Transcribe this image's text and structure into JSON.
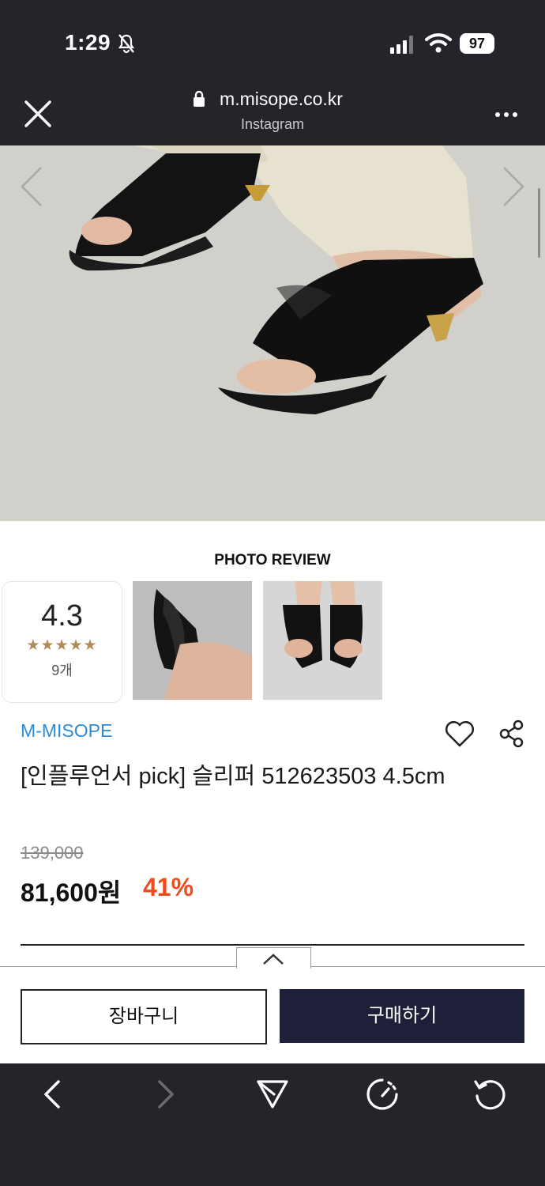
{
  "status_bar": {
    "time": "1:29",
    "battery": "97"
  },
  "browser": {
    "url": "m.misope.co.kr",
    "source": "Instagram"
  },
  "photo_review": {
    "title": "PHOTO REVIEW",
    "rating": "4.3",
    "stars": "★★★★★",
    "count": "9개"
  },
  "product": {
    "brand": "M-MISOPE",
    "title": "[인플루언서 pick] 슬리퍼 512623503 4.5cm",
    "original_price": "139,000",
    "sale_price": "81,600원",
    "discount": "41%"
  },
  "actions": {
    "cart": "장바구니",
    "buy": "구매하기"
  },
  "colors": {
    "brand": "#2b8bd7",
    "discount": "#ee4c1d",
    "buy_button": "#1e2039",
    "chrome": "#24252a"
  }
}
